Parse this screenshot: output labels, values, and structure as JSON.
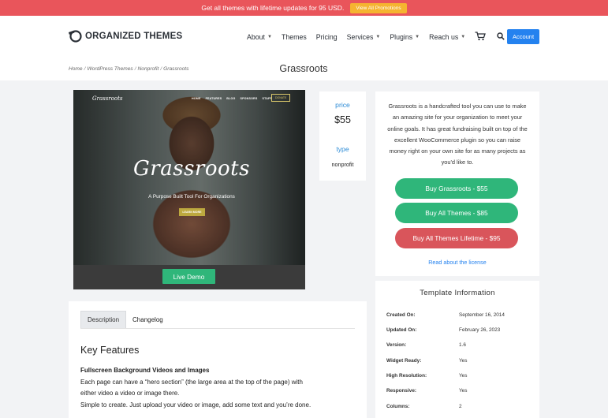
{
  "promo": {
    "text": "Get all themes with lifetime updates for 95 USD.",
    "button": "View All Promotions"
  },
  "header": {
    "logo_text": "ORGANIZED THEMES",
    "nav": [
      {
        "label": "About",
        "has_dropdown": true
      },
      {
        "label": "Themes",
        "has_dropdown": false
      },
      {
        "label": "Pricing",
        "has_dropdown": false
      },
      {
        "label": "Services",
        "has_dropdown": true
      },
      {
        "label": "Plugins",
        "has_dropdown": true
      },
      {
        "label": "Reach us",
        "has_dropdown": true
      }
    ],
    "account_button": "Account",
    "icons": [
      "cart-icon",
      "search-icon",
      "chevron-down-icon"
    ]
  },
  "breadcrumb": [
    "Home",
    "WordPress Themes",
    "Nonprofit",
    "Grassroots"
  ],
  "page_title": "Grassroots",
  "preview": {
    "mini_logo": "Grassroots",
    "mini_nav": [
      "HOME",
      "FEATURES",
      "BLOG",
      "SPONSORS",
      "STAFF"
    ],
    "mini_donate": "DONATE",
    "hero_title": "Grassroots",
    "hero_subtitle": "A Purpose Built Tool For Organizations",
    "hero_button": "LEARN MORE",
    "demo_button": "Live Demo"
  },
  "price": {
    "label": "price",
    "value": "$55",
    "type_label": "type",
    "type_value": "nonprofit"
  },
  "buy": {
    "description": "Grassroots is a handcrafted tool you can use to make an amazing site for your organization to meet your online goals. It has great fundraising built on top of the excellent WooCommerce plugin so you can raise money right on your own site for as many projects as you'd like to.",
    "buttons": [
      {
        "label": "Buy Grassroots - $55",
        "color": "#2fb67a"
      },
      {
        "label": "Buy All Themes - $85",
        "color": "#2fb67a"
      },
      {
        "label": "Buy All Themes Lifetime - $95",
        "color": "#d9555b"
      }
    ],
    "license_link": "Read about the license"
  },
  "template_info": {
    "title": "Template Information",
    "rows": [
      {
        "key": "Created On:",
        "value": "September 16, 2014"
      },
      {
        "key": "Updated On:",
        "value": "February 26, 2023"
      },
      {
        "key": "Version:",
        "value": "1.6"
      },
      {
        "key": "Widget Ready:",
        "value": "Yes"
      },
      {
        "key": "High Resolution:",
        "value": "Yes"
      },
      {
        "key": "Responsive:",
        "value": "Yes"
      },
      {
        "key": "Columns:",
        "value": "2"
      }
    ]
  },
  "description": {
    "tabs": [
      "Description",
      "Changelog"
    ],
    "active_tab": "Description",
    "heading": "Key Features",
    "subheading": "Fullscreen Background Videos and Images",
    "lines": [
      "Each page can have a “hero section” (the large area at the top of the page) with",
      "either video a video or image there.",
      "Simple to create. Just upload your video or image, add some text and you’re done."
    ]
  },
  "colors": {
    "accent_blue": "#2482ef",
    "buy_green": "#2fb67a",
    "buy_red": "#d9555b",
    "promo_red": "#e9555b",
    "promo_button": "#f5b430"
  }
}
